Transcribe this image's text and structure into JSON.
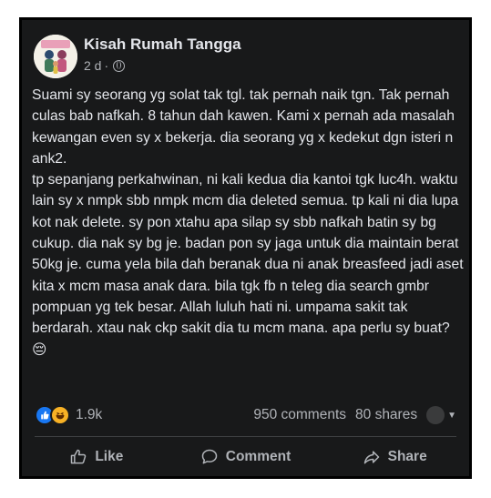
{
  "post": {
    "page_name": "Kisah Rumah Tangga",
    "time": "2 d",
    "separator": "·",
    "privacy_icon": "globe-icon",
    "text": "Suami sy seorang yg solat tak tgl. tak pernah naik tgn. Tak pernah culas bab nafkah. 8 tahun dah kawen. Kami x pernah ada masalah kewangan even sy x bekerja. dia seorang yg x kedekut dgn isteri n ank2.\ntp sepanjang perkahwinan, ni kali kedua dia kantoi tgk luc4h. waktu lain sy x nmpk sbb nmpk mcm dia deleted semua. tp kali ni dia lupa kot nak delete. sy pon xtahu apa silap sy sbb nafkah batin sy bg cukup. dia nak sy bg je. badan pon sy jaga untuk dia maintain berat 50kg je. cuma yela bila dah beranak dua ni anak breasfeed jadi aset kita x mcm masa anak dara. bila tgk fb n teleg dia search gmbr pompuan yg tek besar. Allah luluh hati ni. umpama sakit tak berdarah. xtau nak ckp sakit dia tu mcm mana. apa perlu sy buat? 😔"
  },
  "engagement": {
    "reaction_icons": [
      "like-icon",
      "haha-icon"
    ],
    "reaction_count": "1.9k",
    "comments": "950 comments",
    "shares": "80 shares"
  },
  "actions": {
    "like": "Like",
    "comment": "Comment",
    "share": "Share"
  },
  "colors": {
    "background": "#18191a",
    "text": "#e4e6eb",
    "secondary": "#b0b3b8",
    "like_blue": "#1877f2",
    "haha_yellow": "#f7b125"
  }
}
